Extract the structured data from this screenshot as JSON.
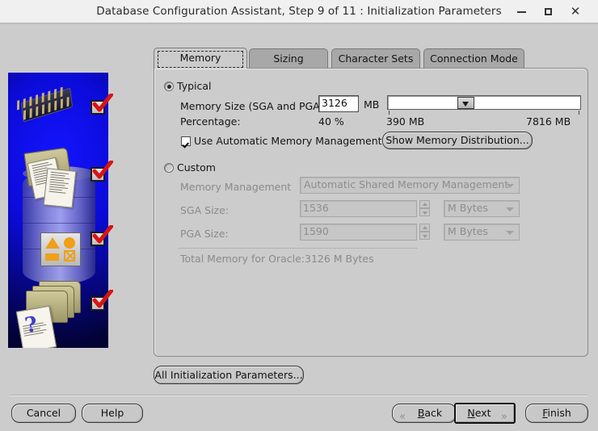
{
  "window": {
    "title": "Database Configuration Assistant, Step 9 of 11 : Initialization Parameters",
    "minimize_label": "Minimize",
    "maximize_label": "Maximize",
    "close_label": "Close"
  },
  "tabs": [
    {
      "label": "Memory",
      "selected": true
    },
    {
      "label": "Sizing",
      "selected": false
    },
    {
      "label": "Character Sets",
      "selected": false
    },
    {
      "label": "Connection Mode",
      "selected": false
    }
  ],
  "memory_tab": {
    "typical": {
      "radio_label": "Typical",
      "selected": true,
      "memory_size_label": "Memory Size (SGA and PGA):",
      "memory_size_value": "3126",
      "memory_size_unit": "MB",
      "percentage_label": "Percentage:",
      "percentage_value": "40 %",
      "slider_min_label": "390 MB",
      "slider_max_label": "7816 MB",
      "slider_position_percent": 40,
      "amm_checkbox_label": "Use Automatic Memory Management",
      "amm_checked": true,
      "show_distribution_button": "Show Memory Distribution..."
    },
    "custom": {
      "radio_label": "Custom",
      "selected": false,
      "memory_management_label": "Memory Management",
      "memory_management_value": "Automatic Shared Memory Management",
      "sga_label": "SGA Size:",
      "sga_value": "1536",
      "sga_unit": "M Bytes",
      "pga_label": "PGA Size:",
      "pga_value": "1590",
      "pga_unit": "M Bytes",
      "total_label": "Total Memory for Oracle:",
      "total_value": "3126 M Bytes",
      "enabled": false
    }
  },
  "all_parameters_button": "All Initialization Parameters...",
  "footer": {
    "cancel": "Cancel",
    "help": "Help",
    "back": "Back",
    "next": "Next",
    "finish": "Finish",
    "back_chevron": "«",
    "next_chevron": "»"
  },
  "colors": {
    "window_background": "#cccccc",
    "titlebar_background": "#f0f0f0",
    "tab_unselected": "#a8a8a8",
    "tab_selected": "#cccccc",
    "banner_blue": "#0b0bd8",
    "checkmark_red": "#d81414",
    "disabled_text": "#8d8d8d"
  },
  "banner": {
    "alt": "Oracle database configuration illustration",
    "items": [
      {
        "icon": "memory-chip-icon",
        "checked": true
      },
      {
        "icon": "folder-documents-icon",
        "checked": true
      },
      {
        "icon": "shapes-panel-icon",
        "checked": true
      },
      {
        "icon": "folders-question-icon",
        "checked": true
      }
    ]
  }
}
